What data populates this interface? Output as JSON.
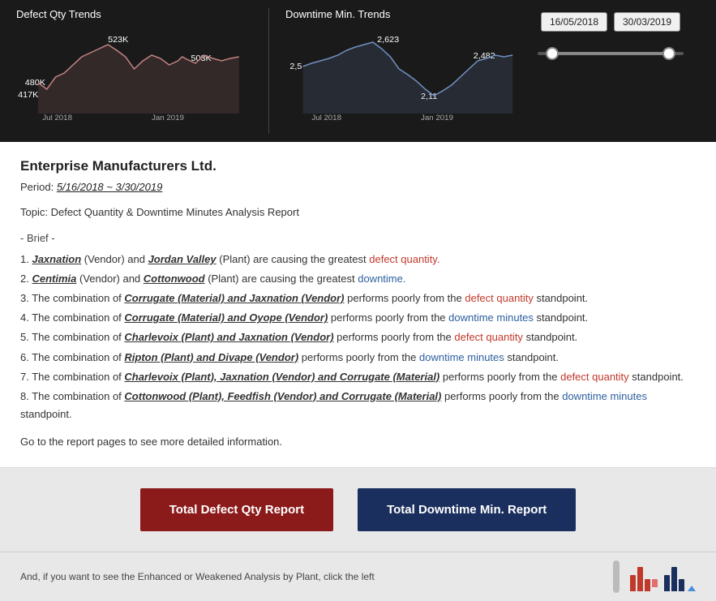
{
  "charts": {
    "defect": {
      "title": "Defect Qty Trends",
      "labels": [
        "Jul 2018",
        "Jan 2019"
      ],
      "values": [
        "480K",
        "417K",
        "523K",
        "503K"
      ],
      "color": "#c08080"
    },
    "downtime": {
      "title": "Downtime Min. Trends",
      "labels": [
        "Jul 2018",
        "Jan 2019"
      ],
      "values": [
        "2,5",
        "2,623",
        "2,11",
        "2,482"
      ],
      "color": "#7090c0"
    }
  },
  "dateRange": {
    "start": "16/05/2018",
    "end": "30/03/2019"
  },
  "company": {
    "name": "Enterprise Manufacturers Ltd.",
    "period_label": "Period:",
    "period_value": "5/16/2018 ~ 3/30/2019",
    "topic_label": "Topic:",
    "topic_value": "Defect Quantity & Downtime Minutes Analysis Report"
  },
  "brief": {
    "label": "- Brief -",
    "items": [
      {
        "id": 1,
        "text_parts": [
          {
            "text": "Jaxnation",
            "style": "bold-italic"
          },
          {
            "text": " (Vendor) and ",
            "style": "normal"
          },
          {
            "text": "Jordan Valley",
            "style": "bold-italic"
          },
          {
            "text": " (Plant) are causing the greatest ",
            "style": "normal"
          },
          {
            "text": "defect quantity.",
            "style": "red"
          }
        ]
      },
      {
        "id": 2,
        "text_parts": [
          {
            "text": "Centimia",
            "style": "bold-italic"
          },
          {
            "text": " (Vendor) and ",
            "style": "normal"
          },
          {
            "text": "Cottonwood",
            "style": "bold-italic"
          },
          {
            "text": " (Plant) are causing the greatest ",
            "style": "normal"
          },
          {
            "text": "downtime.",
            "style": "blue"
          }
        ]
      },
      {
        "id": 3,
        "text_parts": [
          {
            "text": "The combination of ",
            "style": "normal"
          },
          {
            "text": "Corrugate (Material) and Jaxnation (Vendor)",
            "style": "bold-italic"
          },
          {
            "text": " performs poorly from the ",
            "style": "normal"
          },
          {
            "text": "defect quantity",
            "style": "red"
          },
          {
            "text": " standpoint.",
            "style": "normal"
          }
        ]
      },
      {
        "id": 4,
        "text_parts": [
          {
            "text": "The combination of ",
            "style": "normal"
          },
          {
            "text": "Corrugate (Material) and Oyope (Vendor)",
            "style": "bold-italic"
          },
          {
            "text": " performs poorly from the ",
            "style": "normal"
          },
          {
            "text": "downtime minutes",
            "style": "blue"
          },
          {
            "text": " standpoint.",
            "style": "normal"
          }
        ]
      },
      {
        "id": 5,
        "text_parts": [
          {
            "text": "The combination of ",
            "style": "normal"
          },
          {
            "text": "Charlevoix (Plant) and Jaxnation (Vendor)",
            "style": "bold-italic"
          },
          {
            "text": " performs poorly from the ",
            "style": "normal"
          },
          {
            "text": "defect quantity",
            "style": "red"
          },
          {
            "text": " standpoint.",
            "style": "normal"
          }
        ]
      },
      {
        "id": 6,
        "text_parts": [
          {
            "text": "The combination of ",
            "style": "normal"
          },
          {
            "text": "Ripton (Plant) and Divape (Vendor)",
            "style": "bold-italic"
          },
          {
            "text": " performs poorly from the ",
            "style": "normal"
          },
          {
            "text": "downtime minutes",
            "style": "blue"
          },
          {
            "text": " standpoint.",
            "style": "normal"
          }
        ]
      },
      {
        "id": 7,
        "text_parts": [
          {
            "text": "The combination of ",
            "style": "normal"
          },
          {
            "text": "Charlevoix (Plant), Jaxnation (Vendor) and Corrugate (Material)",
            "style": "bold-italic"
          },
          {
            "text": " performs poorly from the ",
            "style": "normal"
          },
          {
            "text": "defect quantity",
            "style": "red"
          },
          {
            "text": " standpoint.",
            "style": "normal"
          }
        ]
      },
      {
        "id": 8,
        "text_parts": [
          {
            "text": "The combination of ",
            "style": "normal"
          },
          {
            "text": "Cottonwood (Plant), Feedfish (Vendor) and Corrugate (Material)",
            "style": "bold-italic"
          },
          {
            "text": " performs poorly from the ",
            "style": "normal"
          },
          {
            "text": "downtime minutes",
            "style": "blue"
          },
          {
            "text": " standpoint.",
            "style": "normal"
          }
        ]
      }
    ],
    "goto_text": "Go to the report pages to see more detailed information."
  },
  "buttons": {
    "defect_report": "Total Defect Qty Report",
    "downtime_report": "Total Downtime Min. Report"
  },
  "bottom": {
    "text": "And, if you want to see the Enhanced or Weakened Analysis by Plant, click the left"
  }
}
